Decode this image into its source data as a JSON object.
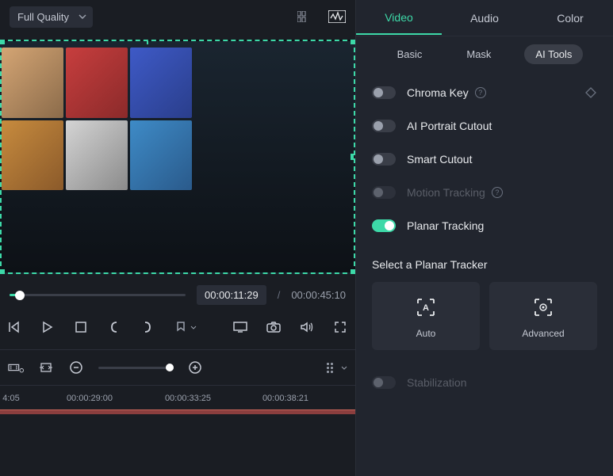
{
  "quality": {
    "selected": "Full Quality"
  },
  "timeline": {
    "current_time": "00:00:11:29",
    "total_time": "00:00:45:10",
    "labels": [
      "4:05",
      "00:00:29:00",
      "00:00:33:25",
      "00:00:38:21"
    ]
  },
  "tabs": {
    "main": {
      "video": "Video",
      "audio": "Audio",
      "color": "Color"
    },
    "sub": {
      "basic": "Basic",
      "mask": "Mask",
      "ai_tools": "AI Tools"
    }
  },
  "options": {
    "chroma_key": "Chroma Key",
    "ai_portrait": "AI Portrait Cutout",
    "smart_cutout": "Smart Cutout",
    "motion_tracking": "Motion Tracking",
    "planar_tracking": "Planar Tracking",
    "stabilization": "Stabilization"
  },
  "tracker": {
    "title": "Select a Planar Tracker",
    "auto": "Auto",
    "advanced": "Advanced"
  }
}
